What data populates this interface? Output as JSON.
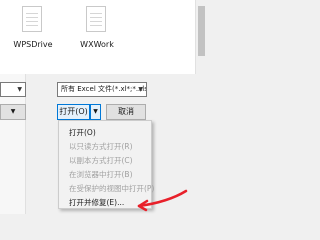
{
  "files": [
    {
      "name": "WPSDrive",
      "icon": "document-icon"
    },
    {
      "name": "WXWork",
      "icon": "document-icon"
    }
  ],
  "filename_combo": {
    "value": "",
    "arrow": "▼"
  },
  "filetype_combo": {
    "value": "所有 Excel 文件(*.xl*;*.xlsx;*.xl",
    "arrow": "▼"
  },
  "open_button": {
    "label": "打开(O)",
    "arrow": "▼"
  },
  "cancel_button": {
    "label": "取消"
  },
  "small_arrow_button": {
    "label": "▼"
  },
  "open_menu": {
    "items": [
      {
        "label": "打开(O)",
        "enabled": true
      },
      {
        "label": "以只读方式打开(R)",
        "enabled": false
      },
      {
        "label": "以副本方式打开(C)",
        "enabled": false
      },
      {
        "label": "在浏览器中打开(B)",
        "enabled": false
      },
      {
        "label": "在受保护的视图中打开(P)",
        "enabled": false
      },
      {
        "label": "打开并修复(E)...",
        "enabled": true
      }
    ]
  },
  "annotation_color": "#e8202a"
}
